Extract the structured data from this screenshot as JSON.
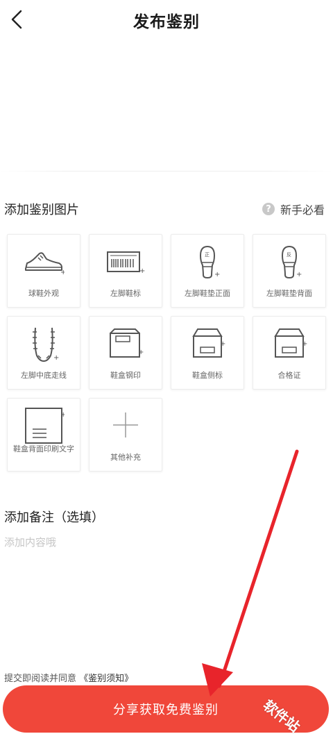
{
  "header": {
    "title": "发布鉴别"
  },
  "upload_section": {
    "title": "添加鉴别图片",
    "guide_label": "新手必看",
    "help_icon_glyph": "?",
    "items": [
      {
        "label": "球鞋外观",
        "icon": "sneaker-icon"
      },
      {
        "label": "左脚鞋标",
        "icon": "barcode-label-icon"
      },
      {
        "label": "左脚鞋垫正面",
        "icon": "insole-front-icon",
        "insole_mark": "正"
      },
      {
        "label": "左脚鞋垫背面",
        "icon": "insole-back-icon",
        "insole_mark": "反"
      },
      {
        "label": "左脚中底走线",
        "icon": "midsole-stitch-icon"
      },
      {
        "label": "鞋盒钢印",
        "icon": "box-stamp-icon"
      },
      {
        "label": "鞋盒侧标",
        "icon": "box-side-label-icon"
      },
      {
        "label": "合格证",
        "icon": "certificate-icon"
      },
      {
        "label": "鞋盒背面印刷文字",
        "icon": "box-back-text-icon"
      },
      {
        "label": "其他补充",
        "icon": "plus-icon"
      }
    ]
  },
  "remarks": {
    "title": "添加备注（选填）",
    "placeholder": "添加内容哦",
    "value": ""
  },
  "agreement": {
    "prefix": "提交即阅读并同意",
    "link": "《鉴别须知》"
  },
  "submit": {
    "label": "分享获取免费鉴别"
  },
  "watermark": {
    "text": "软件站"
  },
  "colors": {
    "accent": "#f0473a",
    "annotation_arrow": "#e8242b"
  }
}
